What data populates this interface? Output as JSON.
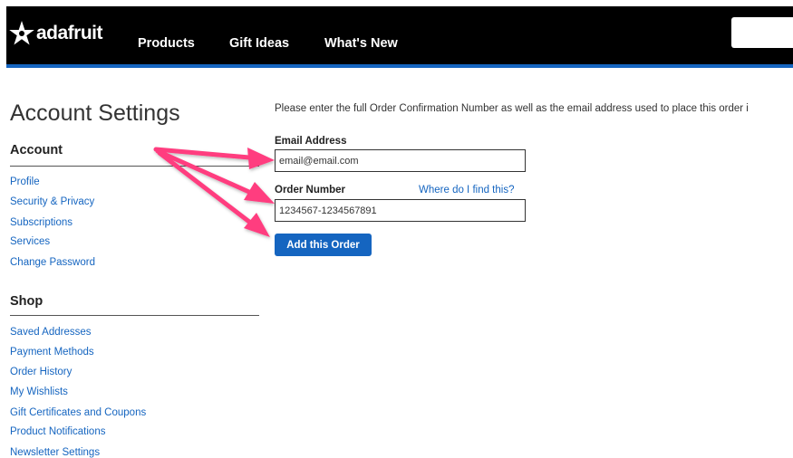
{
  "header": {
    "logo_text": "adafruit",
    "nav": [
      "Products",
      "Gift Ideas",
      "What's New"
    ],
    "search_value": ""
  },
  "sidebar": {
    "title": "Account Settings",
    "account": {
      "heading": "Account",
      "items": [
        "Profile",
        "Security & Privacy",
        "Subscriptions",
        "Services",
        "Change Password"
      ]
    },
    "shop": {
      "heading": "Shop",
      "items": [
        "Saved Addresses",
        "Payment Methods",
        "Order History",
        "My Wishlists",
        "Gift Certificates and Coupons",
        "Product Notifications",
        "Newsletter Settings"
      ]
    }
  },
  "form": {
    "intro": "Please enter the full Order Confirmation Number as well as the email address used to place this order i",
    "email_label": "Email Address",
    "email_value": "email@email.com",
    "order_label": "Order Number",
    "help_link": "Where do I find this?",
    "order_value": "1234567-1234567891",
    "submit_label": "Add this Order"
  },
  "colors": {
    "accent": "#1565c0",
    "navbar": "#000000",
    "arrow": "#ff3d7f"
  },
  "icons": [
    "adafruit-star-icon",
    "arrow-icon"
  ]
}
